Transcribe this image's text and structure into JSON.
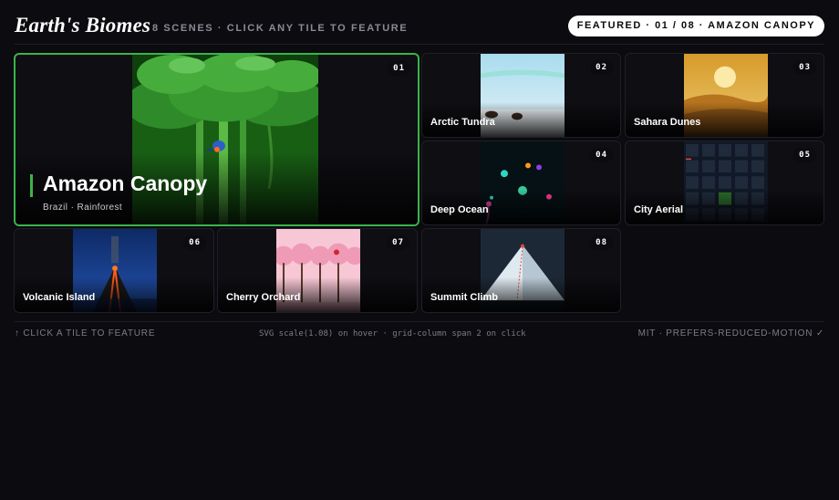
{
  "header": {
    "title": "Earth's Biomes",
    "subtitle": "8 SCENES · CLICK ANY TILE TO FEATURE",
    "featured_pill": "FEATURED · 01 / 08 · AMAZON CANOPY"
  },
  "featured": {
    "title": "Amazon Canopy",
    "subtitle": "Brazil · Rainforest",
    "accent": "#3bb34a"
  },
  "tiles": [
    {
      "num": "01",
      "label": "Amazon Canopy"
    },
    {
      "num": "02",
      "label": "Arctic Tundra"
    },
    {
      "num": "03",
      "label": "Sahara Dunes"
    },
    {
      "num": "04",
      "label": "Deep Ocean"
    },
    {
      "num": "05",
      "label": "City Aerial"
    },
    {
      "num": "06",
      "label": "Volcanic Island"
    },
    {
      "num": "07",
      "label": "Cherry Orchard"
    },
    {
      "num": "08",
      "label": "Summit Climb"
    }
  ],
  "footer": {
    "left": "↑ CLICK A TILE TO FEATURE",
    "middle": "SVG scale(1.08) on hover · grid-column span 2 on click",
    "right": "MIT · PREFERS-REDUCED-MOTION ✓"
  },
  "colors": {
    "background": "#0b0b10",
    "accent": "#3bb34a",
    "pill_bg": "#ffffff"
  }
}
